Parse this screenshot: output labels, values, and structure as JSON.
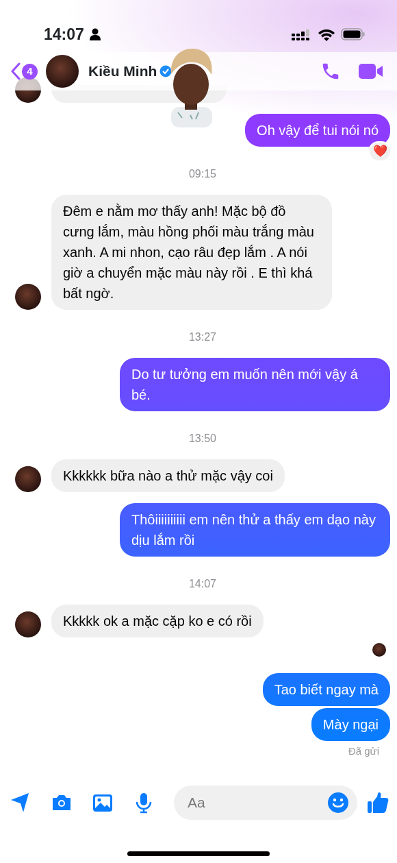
{
  "status_bar": {
    "time": "14:07"
  },
  "header": {
    "unread_count": "4",
    "contact_name": "Kiều Minh",
    "verified": true
  },
  "messages": [
    {
      "kind": "hidden_in"
    },
    {
      "kind": "out",
      "text": "Oh vậy để tui nói nó",
      "reaction": "❤️"
    },
    {
      "kind": "time",
      "text": "09:15"
    },
    {
      "kind": "in",
      "text": "Đêm e nằm mơ thấy anh! Mặc bộ đồ cưng lắm, màu hồng phối màu trắng màu xanh. A mi nhon, cạo râu đẹp lắm . A nói giờ a chuyển mặc màu này rồi . E thì khá bất ngờ."
    },
    {
      "kind": "time",
      "text": "13:27"
    },
    {
      "kind": "out",
      "text": "Do tư tưởng em muốn nên mới vậy á bé."
    },
    {
      "kind": "time",
      "text": "13:50"
    },
    {
      "kind": "in",
      "text": "Kkkkkk bữa nào a thử mặc vậy coi"
    },
    {
      "kind": "out",
      "text": "Thôiiiiiiiiii em nên thử a thấy em dạo này dịu lắm rồi"
    },
    {
      "kind": "time",
      "text": "14:07"
    },
    {
      "kind": "in",
      "text": "Kkkkk ok a mặc cặp ko e có rồi"
    },
    {
      "kind": "seen"
    },
    {
      "kind": "out",
      "text": "Tao biết ngay mà"
    },
    {
      "kind": "out",
      "text": "Mày ngại"
    },
    {
      "kind": "status",
      "text": "Đã gửi"
    }
  ],
  "composer": {
    "placeholder": "Aa"
  }
}
